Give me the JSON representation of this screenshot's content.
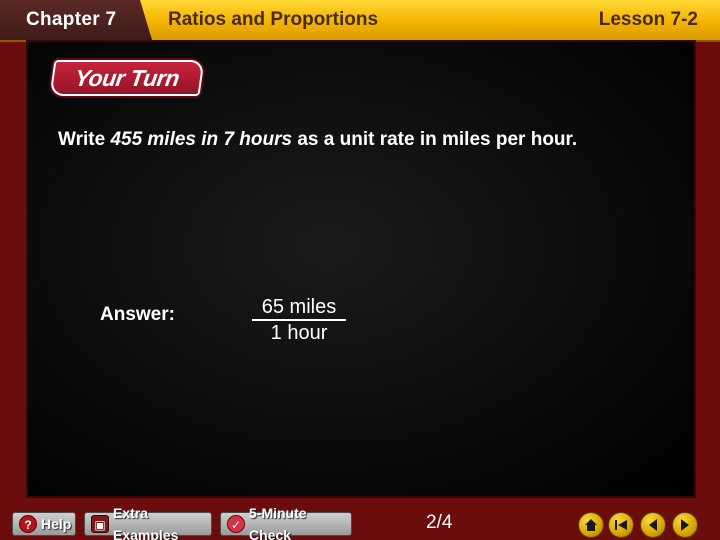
{
  "header": {
    "chapter": "Chapter 7",
    "title": "Ratios and Proportions",
    "lesson": "Lesson 7-2"
  },
  "slide": {
    "badge": "Your Turn",
    "prompt_prefix": "Write ",
    "prompt_emphasis": "455 miles in 7 hours",
    "prompt_suffix": " as a unit rate in miles per hour.",
    "answer_label": "Answer:",
    "answer_numerator": "65 miles",
    "answer_denominator": "1 hour"
  },
  "footer": {
    "help": "Help",
    "extra_examples": "Extra Examples",
    "five_minute_check": "5-Minute Check",
    "page": "2/4"
  },
  "colors": {
    "background": "#6b0d0d",
    "header": "#f3b400",
    "badge": "#c6233a"
  }
}
